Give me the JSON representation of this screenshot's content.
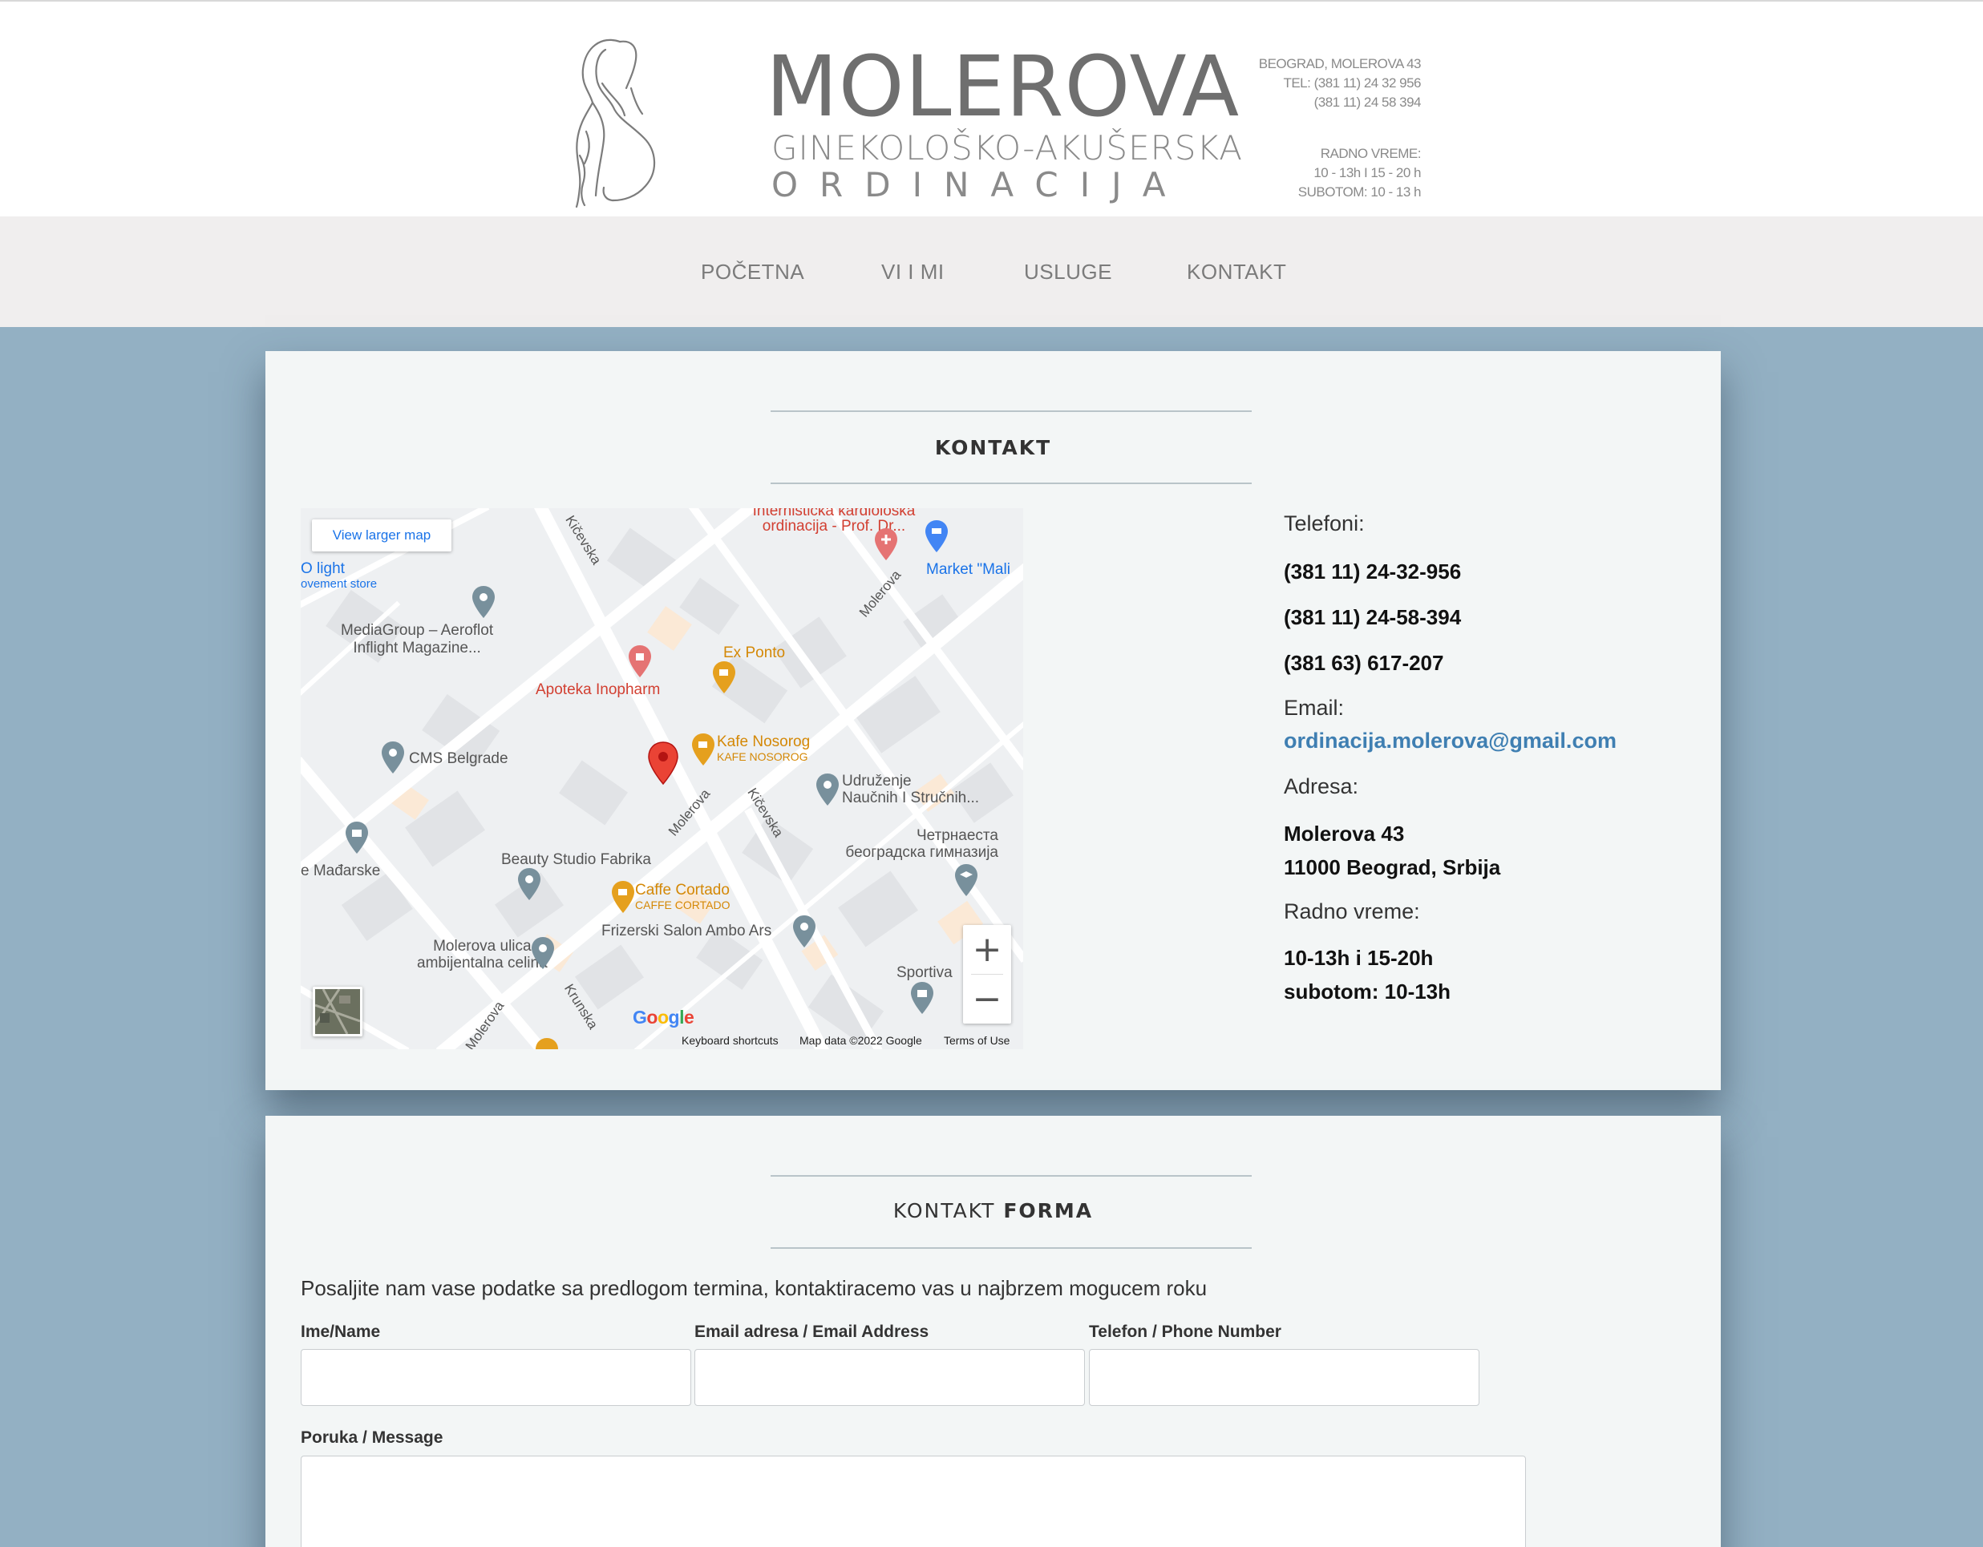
{
  "header": {
    "brand_name": "MOLEROVA",
    "brand_line2": "GINEKOLOŠKO-AKUŠERSKA",
    "brand_line3": "ORDINACIJA",
    "address_line": "BEOGRAD, MOLEROVA 43",
    "tel_line1": "TEL: (381 11) 24 32 956",
    "tel_line2": "(381 11) 24 58 394",
    "hours_title": "RADNO VREME:",
    "hours_week": "10 - 13h I 15 - 20 h",
    "hours_sat": "SUBOTOM: 10 - 13 h"
  },
  "nav": {
    "items": [
      "POČETNA",
      "VI I MI",
      "USLUGE",
      "KONTAKT"
    ]
  },
  "contact_section": {
    "title": "KONTAKT",
    "phones_label": "Telefoni:",
    "phones": [
      "(381 11) 24-32-956",
      "(381 11) 24-58-394",
      "(381 63) 617-207"
    ],
    "email_label": "Email:",
    "email": "ordinacija.molerova@gmail.com",
    "address_label": "Adresa:",
    "address_line1": "Molerova 43",
    "address_line2": "11000 Beograd, Srbija",
    "hours_label": "Radno vreme:",
    "hours_line1": "10-13h i 15-20h",
    "hours_line2": "subotom: 10-13h"
  },
  "map": {
    "view_larger": "View larger map",
    "zoom_in": "+",
    "zoom_out": "−",
    "google": "Google",
    "keyboard_shortcuts": "Keyboard shortcuts",
    "map_data": "Map data ©2022 Google",
    "terms": "Terms of Use",
    "streets": [
      "Kičevska",
      "Kičevska",
      "Molerova",
      "Molerova",
      "Krunska",
      "Molerova"
    ],
    "places": {
      "top_clinic_1": "Internistička kardiološka",
      "top_clinic_2": "ordinacija - Prof. Dr...",
      "market": "Market \"Mali",
      "light_1": "O light",
      "light_2": "ovement store",
      "mediagroup_1": "MediaGroup – Aeroflot",
      "mediagroup_2": "Inflight Magazine...",
      "apoteka": "Apoteka Inopharm",
      "ex_ponto": "Ex Ponto",
      "kafe_1": "Kafe Nosorog",
      "kafe_2": "KAFE NOSOROG",
      "cms": "CMS Belgrade",
      "udruzenje_1": "Udruženje",
      "udruzenje_2": "Naučnih I Stručnih...",
      "gimnazija_1": "Четрнаеста",
      "gimnazija_2": "београдска гимназија",
      "madjarske": "e Mađarske",
      "beauty": "Beauty Studio Fabrika",
      "cortado_1": "Caffe Cortado",
      "cortado_2": "CAFFE CORTADO",
      "frizerski": "Frizerski Salon Ambo Ars",
      "molerova_1": "Molerova ulica",
      "molerova_2": "ambijentalna celina",
      "sportiva": "Sportiva"
    }
  },
  "form_section": {
    "title_light": "KONTAKT",
    "title_bold": "FORMA",
    "intro": "Posaljite nam vase podatke sa predlogom termina, kontaktiracemo vas u najbrzem mogucem roku",
    "name_label": "Ime/Name",
    "email_label": "Email adresa / Email Address",
    "phone_label": "Telefon / Phone Number",
    "message_label": "Poruka / Message",
    "name_value": "",
    "email_value": "",
    "phone_value": "",
    "message_value": ""
  },
  "colors": {
    "page_bg": "#93b0c3",
    "card_bg": "#f3f6f6",
    "link": "#3f7fb2",
    "pin_red": "#ea4335",
    "poi_orange": "#e5a01e",
    "poi_gray": "#78909c"
  }
}
